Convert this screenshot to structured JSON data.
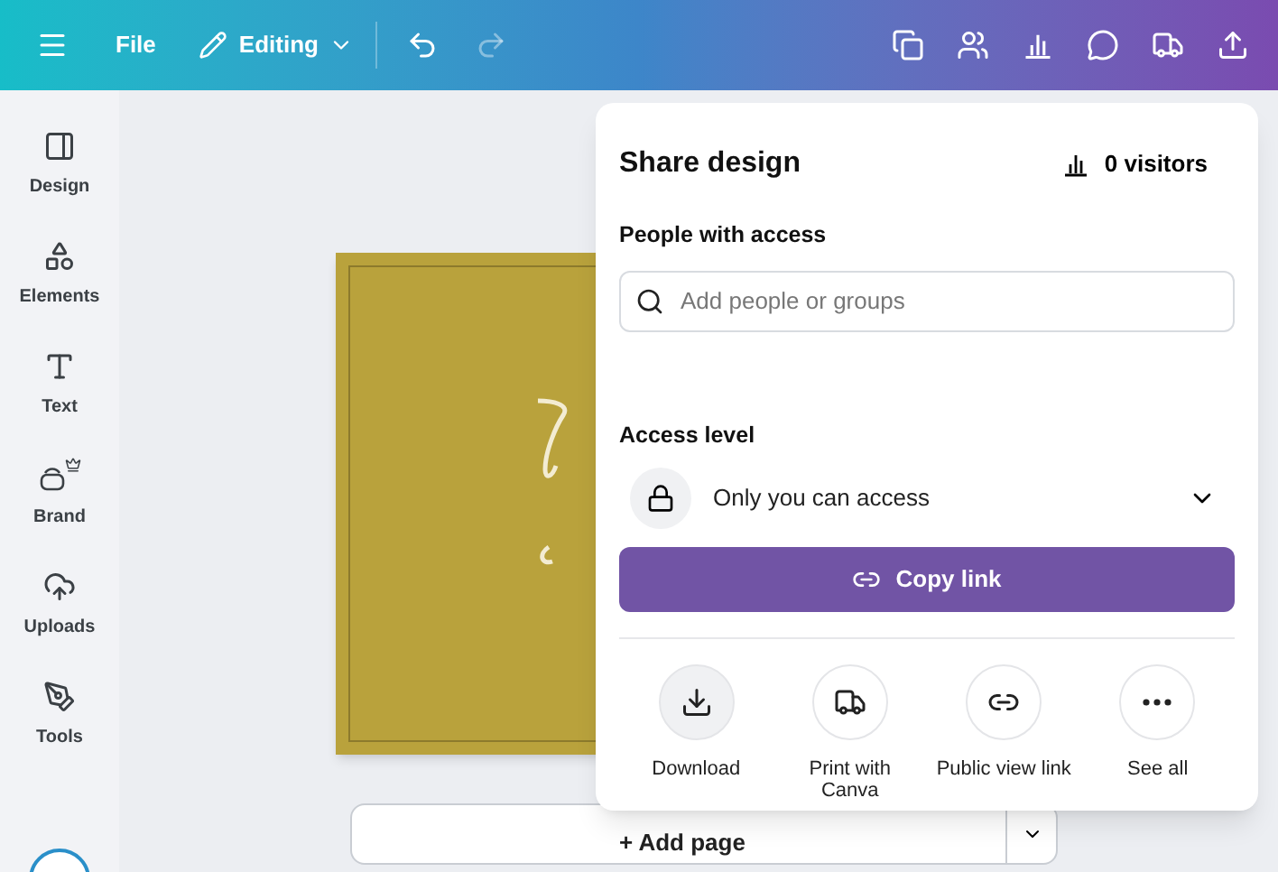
{
  "toolbar": {
    "file_label": "File",
    "mode_label": "Editing",
    "redo_disabled": true
  },
  "sidebar": {
    "items": [
      {
        "label": "Design",
        "kind": "design"
      },
      {
        "label": "Elements",
        "kind": "elements"
      },
      {
        "label": "Text",
        "kind": "text"
      },
      {
        "label": "Brand",
        "kind": "brand"
      },
      {
        "label": "Uploads",
        "kind": "uploads"
      },
      {
        "label": "Tools",
        "kind": "tools"
      }
    ]
  },
  "canvas": {
    "add_page_label": "+ Add page"
  },
  "share_panel": {
    "title": "Share design",
    "visitors": "0 visitors",
    "people_heading": "People with access",
    "search": {
      "placeholder": "Add people or groups"
    },
    "access_heading": "Access level",
    "access_value": "Only you can access",
    "copy_button": "Copy link",
    "actions": [
      {
        "label": "Download",
        "kind": "download"
      },
      {
        "label": "Print with Canva",
        "kind": "print"
      },
      {
        "label": "Public view link",
        "kind": "link"
      },
      {
        "label": "See all",
        "kind": "more"
      }
    ]
  }
}
